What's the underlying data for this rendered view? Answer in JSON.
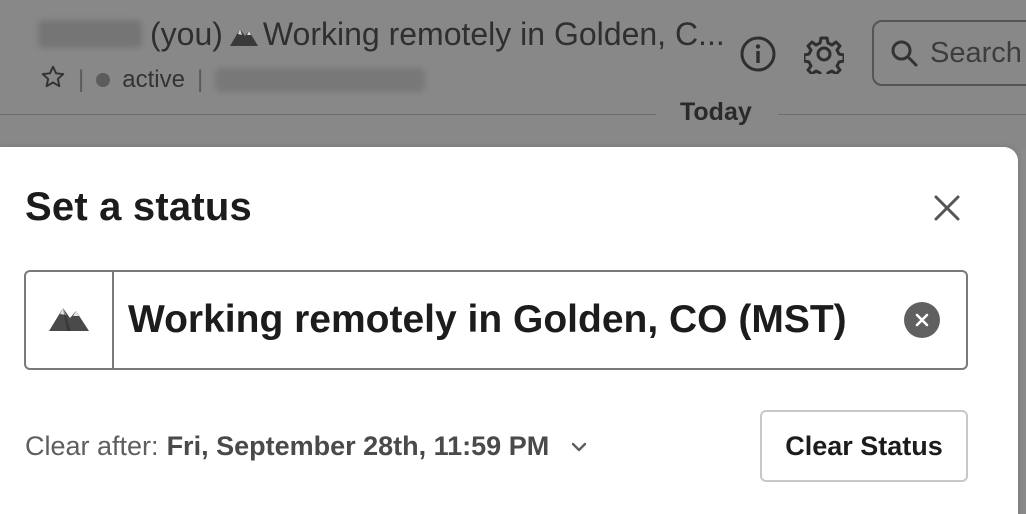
{
  "header": {
    "you_label": "(you)",
    "status_text": "Working remotely in Golden, C...",
    "presence": "active",
    "search_placeholder": "Search",
    "divider_label": "Today"
  },
  "modal": {
    "title": "Set a status",
    "status_value": "Working remotely in Golden, CO (MST)",
    "emoji": "mountain-icon",
    "clear_after_label": "Clear after:",
    "clear_after_value": "Fri, September 28th, 11:59 PM",
    "clear_status_button": "Clear Status"
  },
  "colors": {
    "overlay": "#888888",
    "modal_bg": "#ffffff",
    "text_primary": "#1d1c1d"
  }
}
